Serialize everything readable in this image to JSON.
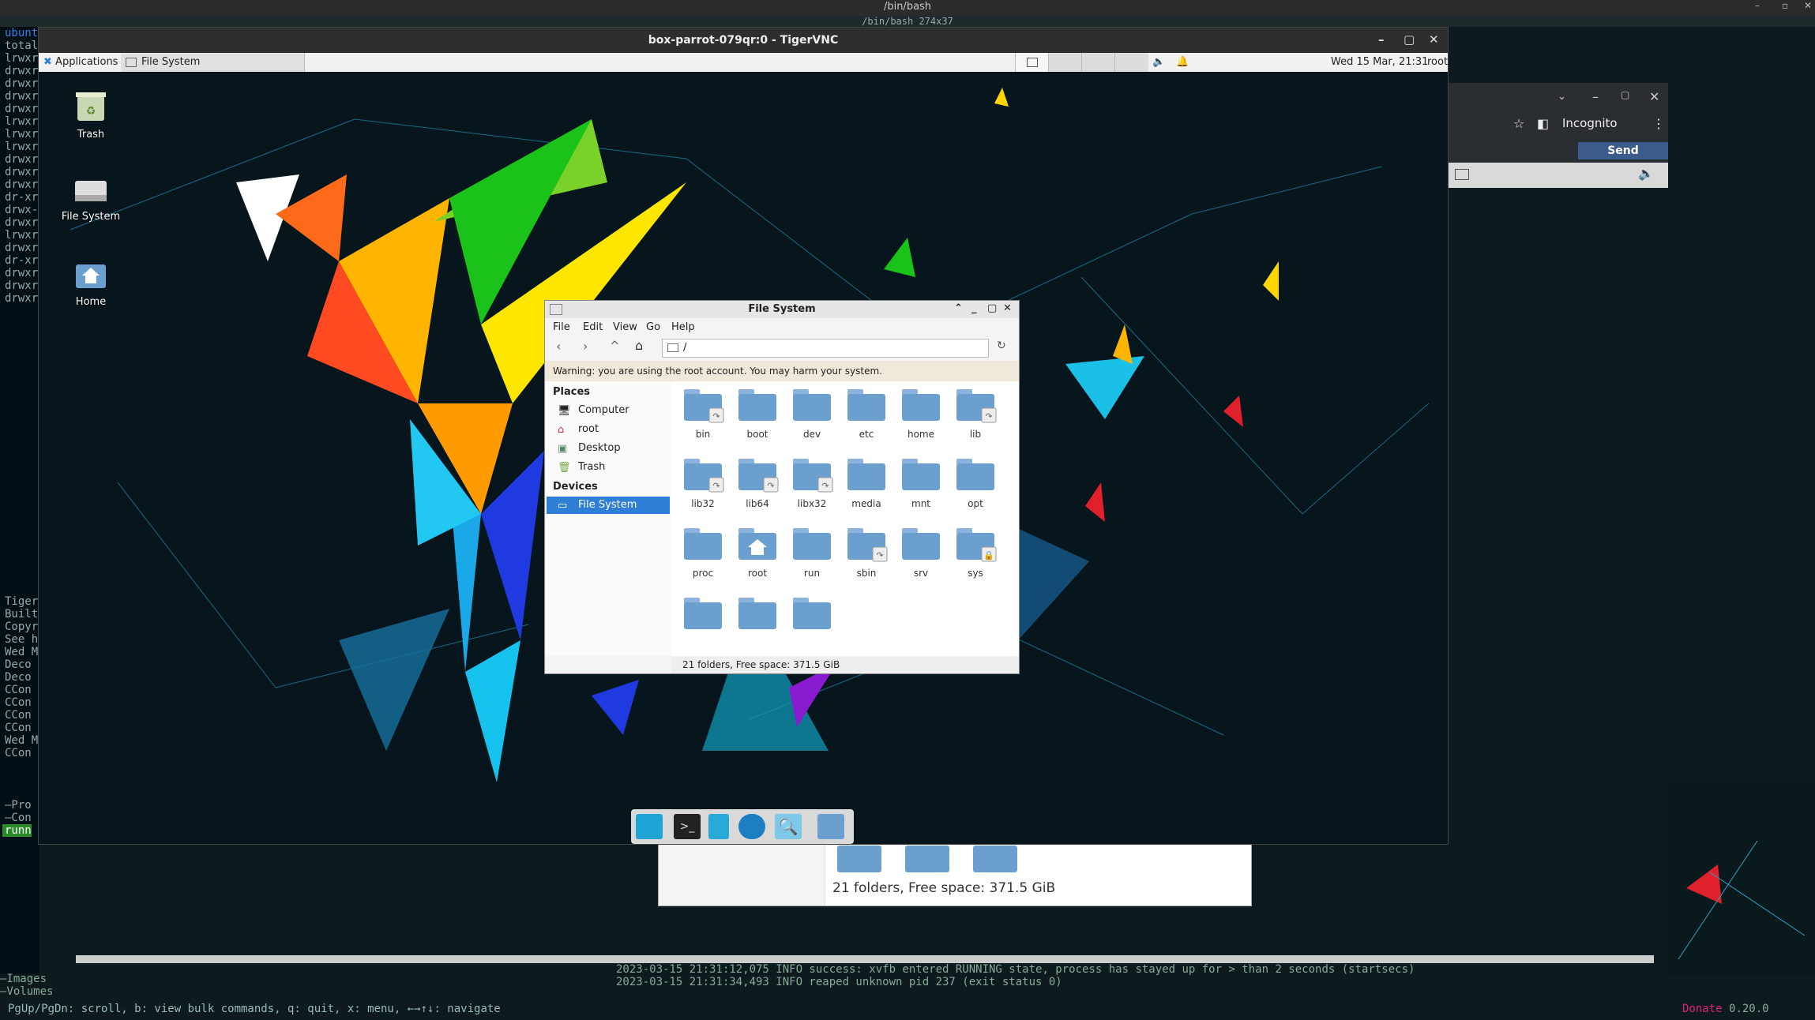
{
  "host": {
    "top_title": "/bin/bash",
    "subtitle": "/bin/bash 274x37",
    "bottom_help": "PgUp/PgDn: scroll, b: view bulk commands, q: quit, x: menu, ←→↑↓: navigate",
    "donate": "Donate",
    "version": "0.20.0",
    "left_panel_lines": [
      "ubunt",
      "total",
      "lrwxr",
      "drwxr",
      "drwxr",
      "drwxr",
      "drwxr",
      "lrwxr",
      "lrwxr",
      "lrwxr",
      "drwxr",
      "drwxr",
      "drwxr",
      "dr-xr",
      "drwx-",
      "drwxr",
      "lrwxr",
      "drwxr",
      "dr-xr",
      "drwxr",
      "drwxr",
      "drwxr"
    ],
    "left_panel_lines2": [
      "Tiger",
      "Built",
      "Copyr",
      "See h",
      "",
      "Wed M",
      " Deco",
      " Deco",
      " CCon",
      " CCon",
      " CCon",
      " CCon",
      "",
      "Wed M",
      " CCon"
    ],
    "left_panel_lines3": [
      "—Pro",
      "—Con",
      "runn"
    ],
    "left_panel_lines4": [
      "—Images",
      "—Volumes"
    ],
    "log_lines": [
      "2023-03-15 21:31:12,075 INFO success: xvfb entered RUNNING state, process has stayed up for > than 2 seconds (startsecs)",
      "2023-03-15 21:31:34,493 INFO reaped unknown pid 237 (exit status 0)"
    ]
  },
  "browser": {
    "incognito_label": "Incognito",
    "send_cad": "Send CtrlAltDel"
  },
  "vnc": {
    "title": "box-parrot-079qr:0 - TigerVNC"
  },
  "panel": {
    "applications": "Applications",
    "task_label": "File System",
    "clock": "Wed 15 Mar, 21:31",
    "user": "root"
  },
  "desktop_icons": [
    {
      "label": "Trash"
    },
    {
      "label": "File System"
    },
    {
      "label": "Home"
    }
  ],
  "file_manager": {
    "title": "File System",
    "menu": [
      "File",
      "Edit",
      "View",
      "Go",
      "Help"
    ],
    "path": "/",
    "warning": "Warning: you are using the root account. You may harm your system.",
    "places_header": "Places",
    "places": [
      {
        "label": "Computer",
        "icon": "computer-icon"
      },
      {
        "label": "root",
        "icon": "home-icon"
      },
      {
        "label": "Desktop",
        "icon": "desktop-icon"
      },
      {
        "label": "Trash",
        "icon": "trash-icon"
      }
    ],
    "devices_header": "Devices",
    "devices": [
      {
        "label": "File System",
        "icon": "drive-icon"
      }
    ],
    "folders": [
      {
        "name": "bin",
        "badge": "link"
      },
      {
        "name": "boot",
        "badge": ""
      },
      {
        "name": "dev",
        "badge": ""
      },
      {
        "name": "etc",
        "badge": ""
      },
      {
        "name": "home",
        "badge": ""
      },
      {
        "name": "lib",
        "badge": "link"
      },
      {
        "name": "lib32",
        "badge": "link"
      },
      {
        "name": "lib64",
        "badge": "link"
      },
      {
        "name": "libx32",
        "badge": "link"
      },
      {
        "name": "media",
        "badge": ""
      },
      {
        "name": "mnt",
        "badge": ""
      },
      {
        "name": "opt",
        "badge": ""
      },
      {
        "name": "proc",
        "badge": ""
      },
      {
        "name": "root",
        "badge": "home"
      },
      {
        "name": "run",
        "badge": ""
      },
      {
        "name": "sbin",
        "badge": "link"
      },
      {
        "name": "srv",
        "badge": ""
      },
      {
        "name": "sys",
        "badge": "lock"
      },
      {
        "name": "",
        "badge": ""
      },
      {
        "name": "",
        "badge": ""
      },
      {
        "name": "",
        "badge": ""
      }
    ],
    "status": "21 folders, Free space: 371.5 GiB"
  },
  "bg_file_manager": {
    "status": "21 folders, Free space: 371.5 GiB"
  },
  "colors": {
    "accent": "#2f7fd6",
    "folder": "#6b9fd0"
  }
}
